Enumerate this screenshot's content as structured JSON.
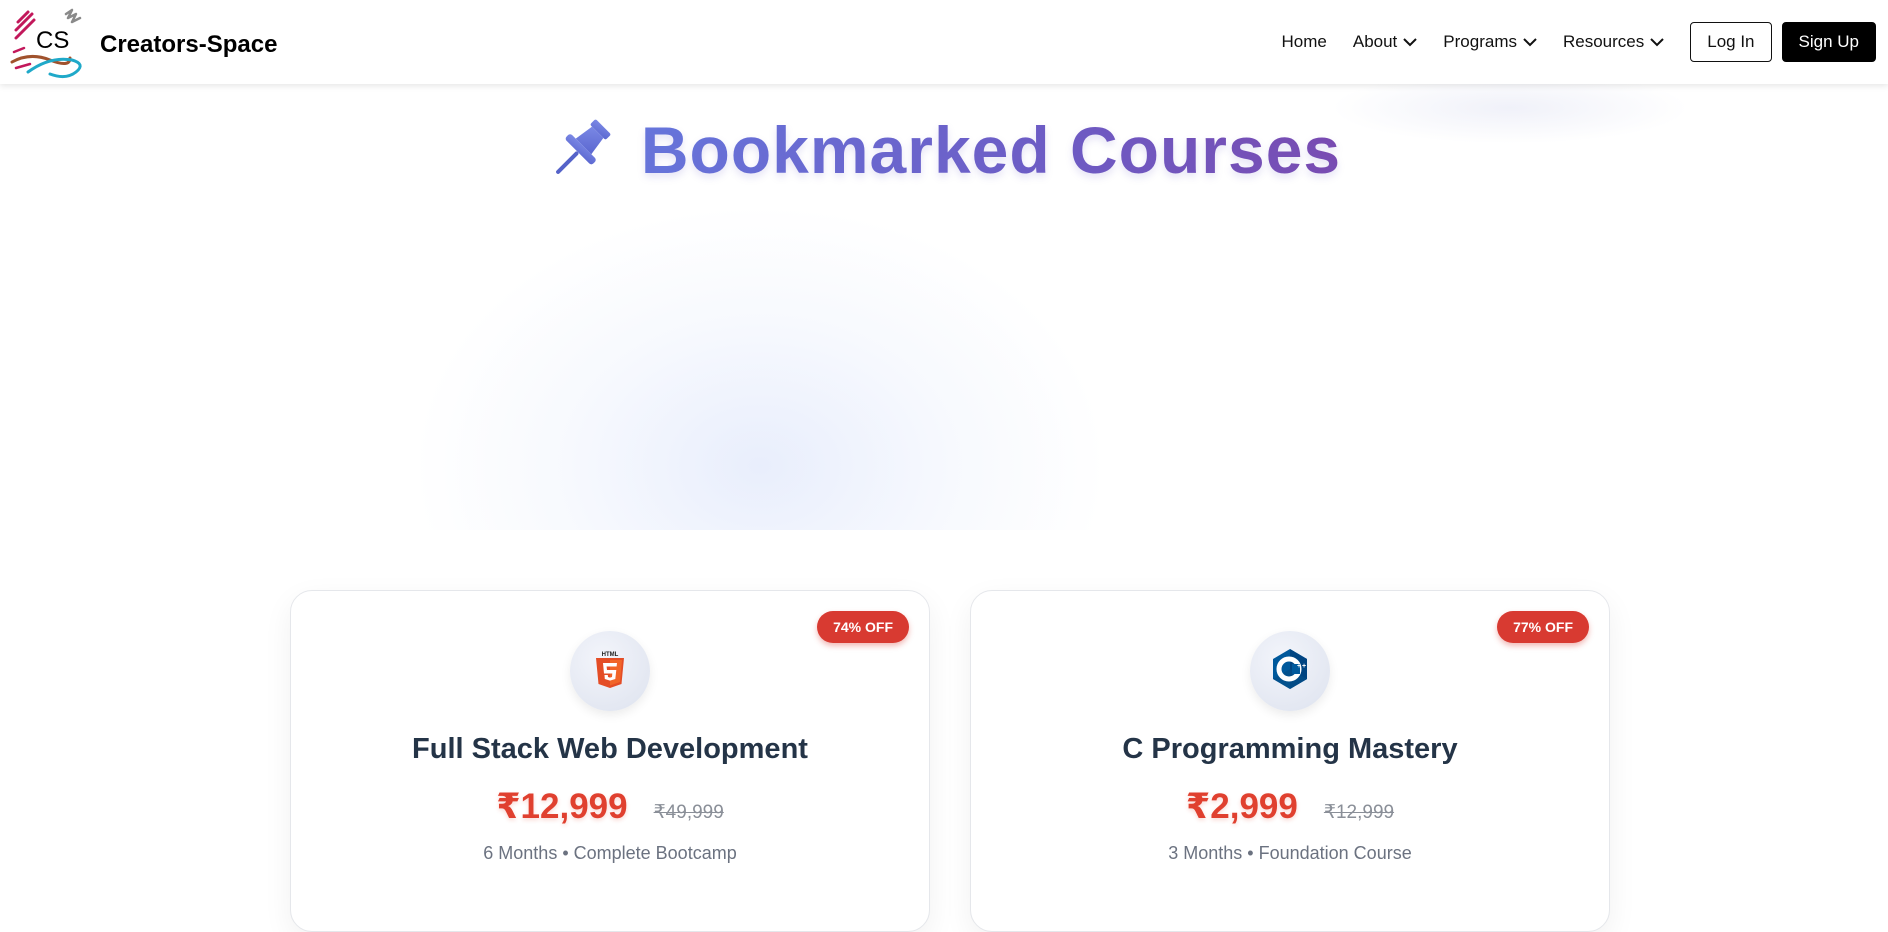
{
  "brand": {
    "logo_text": "CS",
    "name": "Creators-Space"
  },
  "nav": {
    "items": [
      {
        "label": "Home",
        "has_dropdown": false
      },
      {
        "label": "About",
        "has_dropdown": true
      },
      {
        "label": "Programs",
        "has_dropdown": true
      },
      {
        "label": "Resources",
        "has_dropdown": true
      }
    ],
    "login_label": "Log In",
    "signup_label": "Sign Up"
  },
  "page": {
    "title": "Bookmarked Courses",
    "title_icon": "pushpin-icon"
  },
  "courses": [
    {
      "icon": "html5-icon",
      "badge": "74% OFF",
      "title": "Full Stack Web Development",
      "price": "₹12,999",
      "old_price": "₹49,999",
      "meta": "6 Months • Complete Bootcamp"
    },
    {
      "icon": "cplusplus-icon",
      "badge": "77% OFF",
      "title": "C Programming Mastery",
      "price": "₹2,999",
      "old_price": "₹12,999",
      "meta": "3 Months • Foundation Course"
    }
  ],
  "colors": {
    "accent_gradient_start": "#6677dd",
    "accent_gradient_end": "#7a4ab0",
    "price_red": "#e0402f",
    "badge_red": "#d83a31"
  }
}
